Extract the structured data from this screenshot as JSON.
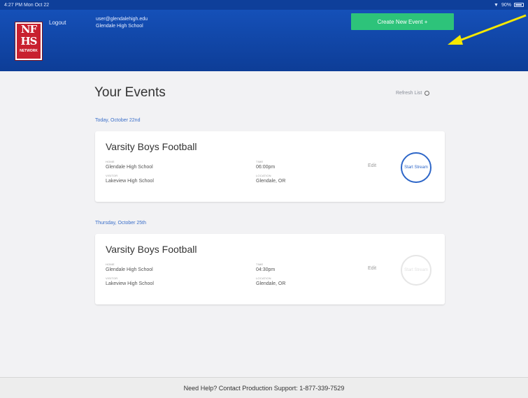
{
  "status_bar": {
    "time": "4:27 PM  Mon Oct 22",
    "battery": "90%"
  },
  "header": {
    "logo_text": [
      "NF",
      "HS",
      "NETWORK"
    ],
    "logout_label": "Logout",
    "email": "user@glendalehigh.edu",
    "school": "Glendale High School",
    "create_label": "Create New Event +"
  },
  "colors": {
    "header_blue": "#0e3f9a",
    "create_green": "#2dc37a",
    "stream_blue": "#2d66c8",
    "arrow_yellow": "#f5e800"
  },
  "main": {
    "title": "Your Events",
    "refresh_label": "Refresh List"
  },
  "events": [
    {
      "date": "Today, October 22nd",
      "title": "Varsity Boys Football",
      "home_label": "HOME",
      "home": "Glendale High School",
      "visitor_label": "VISITOR",
      "visitor": "Lakeview High School",
      "time_label": "TIME",
      "time": "06:00pm",
      "location_label": "LOCATION",
      "location": "Glendale, OR",
      "edit_label": "Edit",
      "stream_label": "Start Stream",
      "stream_enabled": true
    },
    {
      "date": "Thursday, October 25th",
      "title": "Varsity Boys Football",
      "home_label": "HOME",
      "home": "Glendale High School",
      "visitor_label": "VISITOR",
      "visitor": "Lakeview High School",
      "time_label": "TIME",
      "time": "04:30pm",
      "location_label": "LOCATION",
      "location": "Glendale, OR",
      "edit_label": "Edit",
      "stream_label": "Start Stream",
      "stream_enabled": false
    }
  ],
  "footer": {
    "help_text": "Need Help? Contact Production Support: 1-877-339-7529"
  }
}
